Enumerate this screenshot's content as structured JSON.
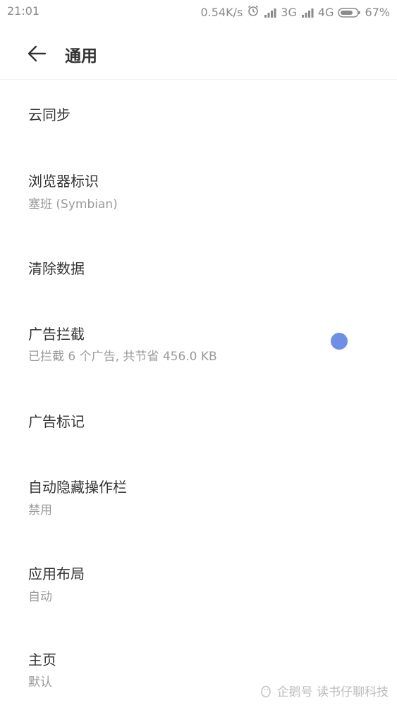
{
  "status_bar": {
    "time": "21:01",
    "network_speed": "0.54K/s",
    "network_1": "3G",
    "network_2": "4G",
    "battery": "67%"
  },
  "header": {
    "title": "通用"
  },
  "settings": {
    "items": [
      {
        "title": "云同步",
        "subtitle": ""
      },
      {
        "title": "浏览器标识",
        "subtitle": "塞班 (Symbian)"
      },
      {
        "title": "清除数据",
        "subtitle": ""
      },
      {
        "title": "广告拦截",
        "subtitle": "已拦截 6 个广告, 共节省 456.0 KB"
      },
      {
        "title": "广告标记",
        "subtitle": ""
      },
      {
        "title": "自动隐藏操作栏",
        "subtitle": "禁用"
      },
      {
        "title": "应用布局",
        "subtitle": "自动"
      },
      {
        "title": "主页",
        "subtitle": "默认"
      }
    ]
  },
  "accent_color": "#6f8fe6",
  "watermark": {
    "text": "企鹅号 读书仔聊科技"
  }
}
